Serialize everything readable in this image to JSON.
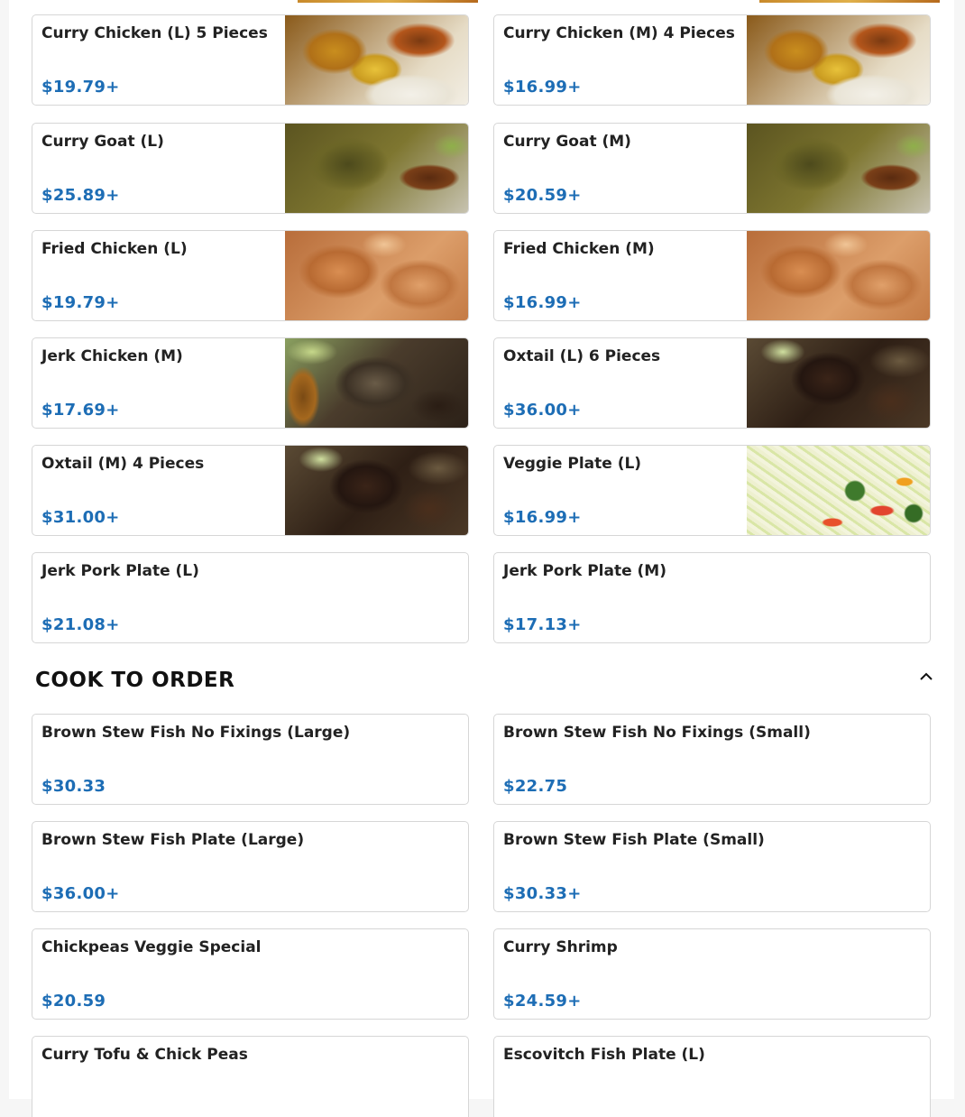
{
  "plates_section": {
    "items": [
      {
        "name": "Curry Chicken (L) 5 Pieces",
        "price": "$19.79+",
        "photo": "curry-chicken-photo"
      },
      {
        "name": "Curry Chicken (M) 4 Pieces",
        "price": "$16.99+",
        "photo": "curry-chicken-photo"
      },
      {
        "name": "Curry Goat (L)",
        "price": "$25.89+",
        "photo": "curry-goat-photo"
      },
      {
        "name": "Curry Goat (M)",
        "price": "$20.59+",
        "photo": "curry-goat-photo"
      },
      {
        "name": "Fried Chicken (L)",
        "price": "$19.79+",
        "photo": "fried-chicken-photo"
      },
      {
        "name": "Fried Chicken (M)",
        "price": "$16.99+",
        "photo": "fried-chicken-photo"
      },
      {
        "name": "Jerk Chicken (M)",
        "price": "$17.69+",
        "photo": "jerk-chicken-photo"
      },
      {
        "name": "Oxtail (L) 6 Pieces",
        "price": "$36.00+",
        "photo": "oxtail-photo"
      },
      {
        "name": "Oxtail (M) 4 Pieces",
        "price": "$31.00+",
        "photo": "oxtail-photo"
      },
      {
        "name": "Veggie Plate (L)",
        "price": "$16.99+",
        "photo": "veggie-photo"
      },
      {
        "name": "Jerk Pork Plate (L)",
        "price": "$21.08+"
      },
      {
        "name": "Jerk Pork Plate (M)",
        "price": "$17.13+"
      }
    ]
  },
  "cook_to_order": {
    "title": "COOK TO ORDER",
    "collapse_icon": "chevron-up-icon",
    "items": [
      {
        "name": "Brown Stew Fish No Fixings (Large)",
        "price": "$30.33"
      },
      {
        "name": "Brown Stew Fish No Fixings (Small)",
        "price": "$22.75"
      },
      {
        "name": "Brown Stew Fish Plate (Large)",
        "price": "$36.00+"
      },
      {
        "name": "Brown Stew Fish Plate (Small)",
        "price": "$30.33+"
      },
      {
        "name": "Chickpeas Veggie Special",
        "price": "$20.59"
      },
      {
        "name": "Curry Shrimp",
        "price": "$24.59+"
      },
      {
        "name": "Curry Tofu & Chick Peas"
      },
      {
        "name": "Escovitch Fish Plate (L)"
      }
    ]
  },
  "colors": {
    "price": "#1d6db5",
    "border": "#d6d6d6",
    "heading": "#111111"
  }
}
